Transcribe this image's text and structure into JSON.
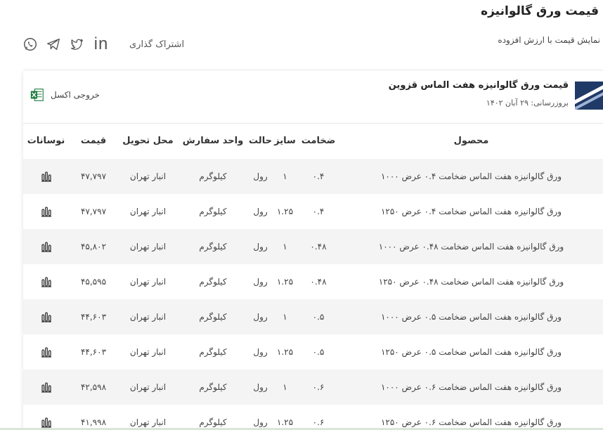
{
  "page": {
    "title": "قیمت ورق گالوانیزه",
    "vat_option": "نمایش قیمت با ارزش افزوده",
    "share_label": "اشتراک گذاری",
    "share_icons": [
      "linkedin-icon",
      "twitter-icon",
      "telegram-icon",
      "whatsapp-icon"
    ]
  },
  "card": {
    "title": "قیمت ورق گالوانیزه هفت الماس قزوین",
    "update": "بروزرسانی: ۲۹ آبان ۱۴۰۲",
    "excel_label": "خروجی اکسل"
  },
  "table": {
    "headers": {
      "product": "محصول",
      "thickness": "ضخامت",
      "size": "سایز",
      "state": "حالت",
      "unit": "واحد سفارش",
      "delivery": "محل تحویل",
      "price": "قیمت",
      "fluctuation": "نوسانات"
    },
    "rows": [
      {
        "product": "ورق گالوانیزه هفت الماس ضخامت ۰.۴ عرض ۱۰۰۰",
        "thickness": "۰.۴",
        "size": "۱",
        "state": "رول",
        "unit": "کیلوگرم",
        "delivery": "انبار تهران",
        "price": "۴۷,۷۹۷"
      },
      {
        "product": "ورق گالوانیزه هفت الماس ضخامت ۰.۴ عرض ۱۲۵۰",
        "thickness": "۰.۴",
        "size": "۱.۲۵",
        "state": "رول",
        "unit": "کیلوگرم",
        "delivery": "انبار تهران",
        "price": "۴۷,۷۹۷"
      },
      {
        "product": "ورق گالوانیزه هفت الماس ضخامت ۰.۴۸ عرض ۱۰۰۰",
        "thickness": "۰.۴۸",
        "size": "۱",
        "state": "رول",
        "unit": "کیلوگرم",
        "delivery": "انبار تهران",
        "price": "۴۵,۸۰۲"
      },
      {
        "product": "ورق گالوانیزه هفت الماس ضخامت ۰.۴۸ عرض ۱۲۵۰",
        "thickness": "۰.۴۸",
        "size": "۱.۲۵",
        "state": "رول",
        "unit": "کیلوگرم",
        "delivery": "انبار تهران",
        "price": "۴۵,۵۹۵"
      },
      {
        "product": "ورق گالوانیزه هفت الماس ضخامت ۰.۵ عرض ۱۰۰۰",
        "thickness": "۰.۵",
        "size": "۱",
        "state": "رول",
        "unit": "کیلوگرم",
        "delivery": "انبار تهران",
        "price": "۴۴,۶۰۳"
      },
      {
        "product": "ورق گالوانیزه هفت الماس ضخامت ۰.۵ عرض ۱۲۵۰",
        "thickness": "۰.۵",
        "size": "۱.۲۵",
        "state": "رول",
        "unit": "کیلوگرم",
        "delivery": "انبار تهران",
        "price": "۴۴,۶۰۳"
      },
      {
        "product": "ورق گالوانیزه هفت الماس ضخامت ۰.۶ عرض ۱۰۰۰",
        "thickness": "۰.۶",
        "size": "۱",
        "state": "رول",
        "unit": "کیلوگرم",
        "delivery": "انبار تهران",
        "price": "۴۲,۵۹۸"
      },
      {
        "product": "ورق گالوانیزه هفت الماس ضخامت ۰.۶ عرض ۱۲۵۰",
        "thickness": "۰.۶",
        "size": "۱.۲۵",
        "state": "رول",
        "unit": "کیلوگرم",
        "delivery": "انبار تهران",
        "price": "۴۱,۹۹۸"
      }
    ]
  },
  "colors": {
    "row_stripe": "#f4f4f4",
    "logo": "#1f3a66",
    "excel_green": "#1d7a3e"
  }
}
